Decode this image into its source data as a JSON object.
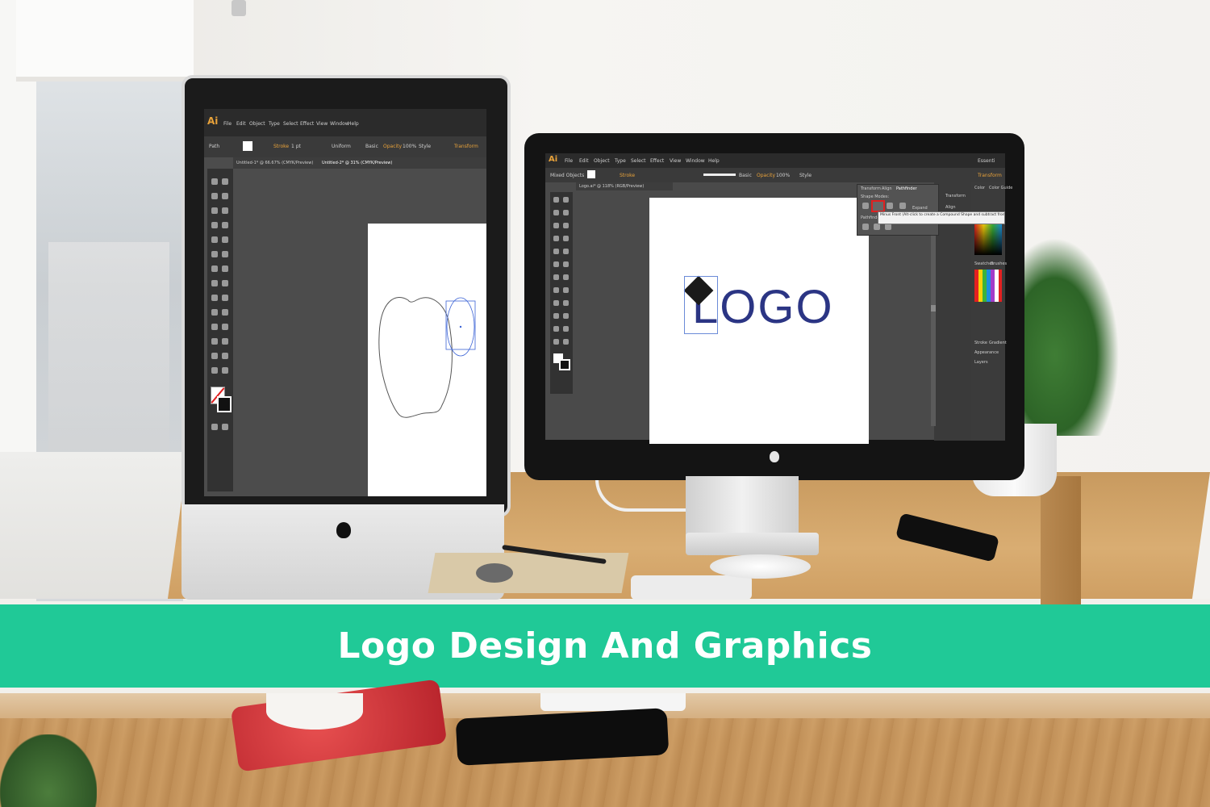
{
  "banner": {
    "title": "Logo Design And Graphics",
    "color": "#20c997"
  },
  "left_screen": {
    "app_badge": "Ai",
    "menu": [
      "File",
      "Edit",
      "Object",
      "Type",
      "Select",
      "Effect",
      "View",
      "Window",
      "Help"
    ],
    "control_bar": {
      "selection": "Path",
      "stroke_label": "Stroke",
      "stroke_weight": "1 pt",
      "profile": "Uniform",
      "brush": "Basic",
      "opacity_label": "Opacity",
      "opacity": "100%",
      "style_label": "Style",
      "transform_label": "Transform"
    },
    "doc_tabs": [
      "Untitled-1* @ 66.67% (CMYK/Preview)",
      "Untitled-2* @ 31% (CMYK/Preview)"
    ]
  },
  "right_screen": {
    "app_badge": "Ai",
    "menu": [
      "File",
      "Edit",
      "Object",
      "Type",
      "Select",
      "Effect",
      "View",
      "Window",
      "Help"
    ],
    "workspace": "Essenti",
    "control_bar": {
      "selection": "Mixed Objects",
      "stroke_label": "Stroke",
      "brush": "Basic",
      "opacity_label": "Opacity",
      "opacity": "100%",
      "style_label": "Style",
      "transform_label": "Transform"
    },
    "doc_tab": "Logo.ai* @ 118% (RGB/Preview)",
    "artboard_text": "LOGO",
    "pathfinder_panel": {
      "tabs": [
        "Transform",
        "Align",
        "Pathfinder"
      ],
      "shape_modes_label": "Shape Modes:",
      "pathfinders_label": "Pathfinders:",
      "expand": "Expand"
    },
    "tooltip": "Minus Front (Alt-click to create a Compound Shape and subtract front shape area)",
    "side_panels": [
      "Transform",
      "Align",
      "Color",
      "Color Guide",
      "Swatches",
      "Brushes",
      "Stroke",
      "Gradient",
      "Appearance",
      "Layers"
    ],
    "logo_color": "#2b3584",
    "highlight_color": "#e02020"
  }
}
